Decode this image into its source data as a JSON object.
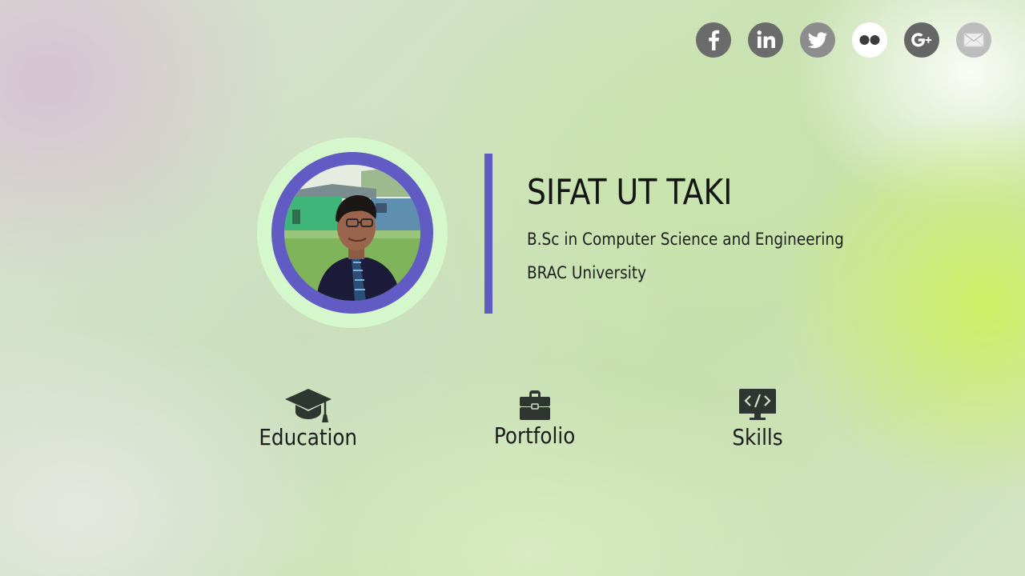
{
  "social": [
    {
      "id": "facebook",
      "icon": "facebook-icon",
      "color": "#6b6b6b"
    },
    {
      "id": "linkedin",
      "icon": "linkedin-icon",
      "color": "#6b6b6b"
    },
    {
      "id": "twitter",
      "icon": "twitter-icon",
      "color": "#8d8d8d"
    },
    {
      "id": "flickr",
      "icon": "flickr-icon",
      "color": "#ffffff"
    },
    {
      "id": "google-plus",
      "icon": "google-plus-icon",
      "color": "#666666"
    },
    {
      "id": "email",
      "icon": "envelope-icon",
      "color": "#bdbdbd"
    }
  ],
  "profile": {
    "name": "SIFAT UT TAKI",
    "degree": "B.Sc in Computer Science and Engineering",
    "university": "BRAC University",
    "accent_color": "#625bc4",
    "outer_ring_color": "#d4f8cc"
  },
  "nav": [
    {
      "label": "Education",
      "icon": "graduation-cap-icon"
    },
    {
      "label": "Portfolio",
      "icon": "briefcase-icon"
    },
    {
      "label": "Skills",
      "icon": "code-monitor-icon"
    }
  ]
}
